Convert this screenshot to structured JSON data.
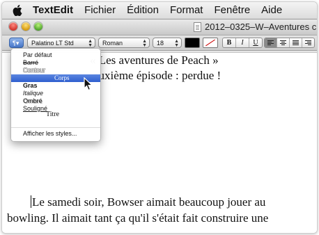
{
  "menubar": {
    "app": "TextEdit",
    "items": [
      "Fichier",
      "Édition",
      "Format",
      "Fenêtre",
      "Aide"
    ],
    "apple_icon": "apple-icon"
  },
  "window": {
    "title": "2012–0325–W–Aventures c",
    "doc_icon": "document-icon"
  },
  "toolbar": {
    "styles_label": "¶▾",
    "font_family": "Palatino LT Std",
    "typeface": "Roman",
    "size": "18",
    "bold_label": "B",
    "italic_label": "I",
    "underline_label": "U",
    "text_color": "#000000",
    "bg_color": "#ffffff"
  },
  "document": {
    "title_line": "« Les aventures de Peach »",
    "subtitle_line": "euxième épisode : perdue !",
    "para_line1": "Le samedi soir, Bowser aimait beaucoup jouer au",
    "para_line2": "bowling. Il aimait tant ça qu'il s'était fait construire une"
  },
  "styles_menu": {
    "items": [
      {
        "label": "Par défaut"
      },
      {
        "label": "Barré"
      },
      {
        "label": "Contour"
      },
      {
        "label": "Corps"
      },
      {
        "label": "Gras"
      },
      {
        "label": "Italique"
      },
      {
        "label": "Ombré"
      },
      {
        "label": "Souligné"
      }
    ],
    "side_label": "Titre",
    "selected": "Corps",
    "more": "Afficher les styles..."
  },
  "colors": {
    "selection": "#2f5fcf",
    "menubar_bg": "#e6e6e6"
  }
}
